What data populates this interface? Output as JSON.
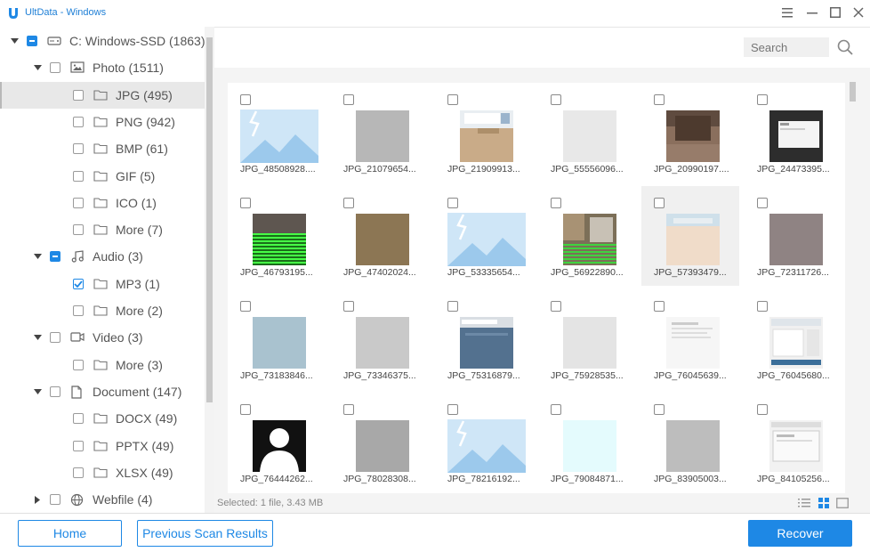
{
  "window": {
    "title": "UltData - Windows",
    "accent": "#1e88e5"
  },
  "tree": [
    {
      "label": "C: Windows-SSD (1863)",
      "icon": "drive-icon",
      "state": "partial",
      "caret": "down",
      "level": 0
    },
    {
      "label": "Photo (1511)",
      "icon": "image-icon",
      "state": "unchecked",
      "caret": "down",
      "level": 1
    },
    {
      "label": "JPG (495)",
      "icon": "folder-icon",
      "state": "unchecked",
      "caret": "none",
      "level": 2,
      "selected": true
    },
    {
      "label": "PNG (942)",
      "icon": "folder-icon",
      "state": "unchecked",
      "caret": "none",
      "level": 2
    },
    {
      "label": "BMP (61)",
      "icon": "folder-icon",
      "state": "unchecked",
      "caret": "none",
      "level": 2
    },
    {
      "label": "GIF (5)",
      "icon": "folder-icon",
      "state": "unchecked",
      "caret": "none",
      "level": 2
    },
    {
      "label": "ICO (1)",
      "icon": "folder-icon",
      "state": "unchecked",
      "caret": "none",
      "level": 2
    },
    {
      "label": "More (7)",
      "icon": "folder-icon",
      "state": "unchecked",
      "caret": "none",
      "level": 2
    },
    {
      "label": "Audio (3)",
      "icon": "music-icon",
      "state": "partial",
      "caret": "down",
      "level": 1
    },
    {
      "label": "MP3 (1)",
      "icon": "folder-icon",
      "state": "checked",
      "caret": "none",
      "level": 2
    },
    {
      "label": "More (2)",
      "icon": "folder-icon",
      "state": "unchecked",
      "caret": "none",
      "level": 2
    },
    {
      "label": "Video (3)",
      "icon": "video-icon",
      "state": "unchecked",
      "caret": "down",
      "level": 1
    },
    {
      "label": "More (3)",
      "icon": "folder-icon",
      "state": "unchecked",
      "caret": "none",
      "level": 2
    },
    {
      "label": "Document (147)",
      "icon": "document-icon",
      "state": "unchecked",
      "caret": "down",
      "level": 1
    },
    {
      "label": "DOCX (49)",
      "icon": "folder-icon",
      "state": "unchecked",
      "caret": "none",
      "level": 2
    },
    {
      "label": "PPTX (49)",
      "icon": "folder-icon",
      "state": "unchecked",
      "caret": "none",
      "level": 2
    },
    {
      "label": "XLSX (49)",
      "icon": "folder-icon",
      "state": "unchecked",
      "caret": "none",
      "level": 2
    },
    {
      "label": "Webfile (4)",
      "icon": "globe-icon",
      "state": "unchecked",
      "caret": "right",
      "level": 1
    }
  ],
  "search": {
    "placeholder": "Search"
  },
  "files": [
    {
      "name": "JPG_48508928....",
      "thumb": "placeholder"
    },
    {
      "name": "JPG_21079654...",
      "thumb": "gray",
      "color": "#b7b7b7"
    },
    {
      "name": "JPG_21909913...",
      "thumb": "screenshot-desk"
    },
    {
      "name": "JPG_55556096...",
      "thumb": "gray",
      "color": "#e8e8e8"
    },
    {
      "name": "JPG_20990197....",
      "thumb": "room"
    },
    {
      "name": "JPG_24473395...",
      "thumb": "dark-screen"
    },
    {
      "name": "JPG_46793195...",
      "thumb": "green-glitch"
    },
    {
      "name": "JPG_47402024...",
      "thumb": "gray",
      "color": "#8c7654"
    },
    {
      "name": "JPG_53335654...",
      "thumb": "placeholder"
    },
    {
      "name": "JPG_56922890...",
      "thumb": "street-glitch"
    },
    {
      "name": "JPG_57393479...",
      "thumb": "beige",
      "hover": true
    },
    {
      "name": "JPG_72311726...",
      "thumb": "gray",
      "color": "#8f8383"
    },
    {
      "name": "JPG_73183846...",
      "thumb": "gray",
      "color": "#a9c2cf"
    },
    {
      "name": "JPG_73346375...",
      "thumb": "gray",
      "color": "#c9c9c9"
    },
    {
      "name": "JPG_75316879...",
      "thumb": "blue-app"
    },
    {
      "name": "JPG_75928535...",
      "thumb": "gray",
      "color": "#e4e4e4"
    },
    {
      "name": "JPG_76045639...",
      "thumb": "doc-screen"
    },
    {
      "name": "JPG_76045680...",
      "thumb": "doc-screen-2"
    },
    {
      "name": "JPG_76444262...",
      "thumb": "avatar"
    },
    {
      "name": "JPG_78028308...",
      "thumb": "gray",
      "color": "#a8a8a8"
    },
    {
      "name": "JPG_78216192...",
      "thumb": "placeholder"
    },
    {
      "name": "JPG_79084871...",
      "thumb": "gray",
      "color": "#e4fbfd"
    },
    {
      "name": "JPG_83905003...",
      "thumb": "gray",
      "color": "#bdbdbd"
    },
    {
      "name": "JPG_84105256...",
      "thumb": "doc-screen-3"
    }
  ],
  "status": {
    "text": "Selected: 1 file, 3.43 MB"
  },
  "buttons": {
    "home": "Home",
    "previous": "Previous Scan Results",
    "recover": "Recover"
  }
}
